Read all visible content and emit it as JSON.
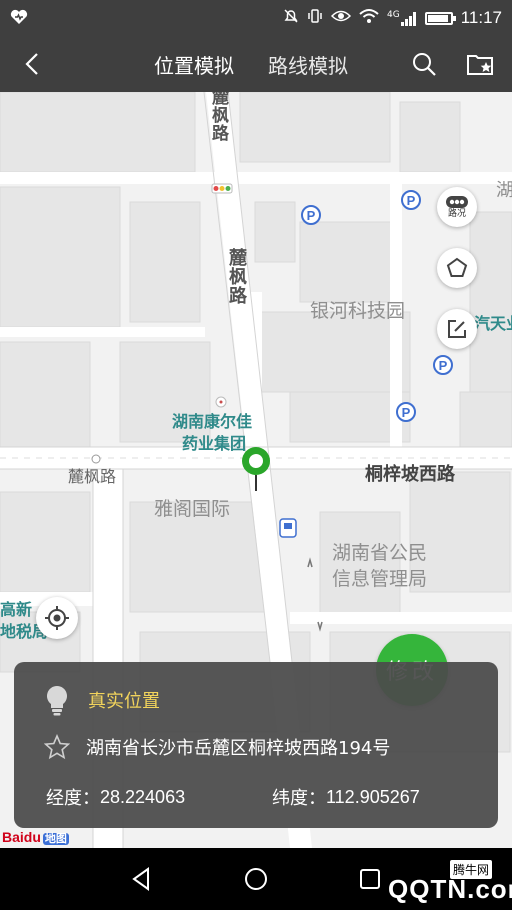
{
  "status_bar": {
    "time": "11:17",
    "network": "4G",
    "battery_level": 0.9,
    "icons": [
      "heart-icon",
      "mute-icon",
      "vibrate-icon",
      "eye-icon",
      "wifi-icon",
      "signal-icon",
      "battery-icon"
    ]
  },
  "app_bar": {
    "tabs": [
      {
        "label": "位置模拟",
        "active": true
      },
      {
        "label": "路线模拟",
        "active": false
      }
    ],
    "icons": [
      "back-icon",
      "search-icon",
      "favorites-folder-icon"
    ]
  },
  "map": {
    "roads": [
      "麓枫路",
      "麓枫路",
      "桐梓坡西路",
      "麓枫路"
    ],
    "pois_gray": [
      "银河科技园",
      "雅阁国际",
      "湖南省公民",
      "信息管理局"
    ],
    "pois_teal": [
      "湖南康尔佳",
      "药业集团",
      "高新",
      "地税局",
      "汽天业"
    ],
    "side_label": "湖",
    "parking_label": "P",
    "fab_traffic_label": "路况",
    "fab_icons": [
      "traffic-icon",
      "pentagon-icon",
      "edit-icon",
      "locate-icon"
    ]
  },
  "info_card": {
    "title": "真实位置",
    "address": "湖南省长沙市岳麓区桐梓坡西路194号",
    "latitude_label": "经度：",
    "latitude_value": "28.224063",
    "longitude_label": "纬度：",
    "longitude_value": "112.905267"
  },
  "modify_button": {
    "label": "修改"
  },
  "baidu_logo": {
    "text": "Baidu",
    "suffix": "地图"
  },
  "watermark": {
    "brand": "QQTN.com",
    "tag": "腾牛网"
  },
  "colors": {
    "bar": "#3f3f3f",
    "accent_green": "#35b53b",
    "title_yellow": "#f2d45c",
    "poi_teal": "#2f8a8a",
    "parking_blue": "#3f6fd0"
  }
}
